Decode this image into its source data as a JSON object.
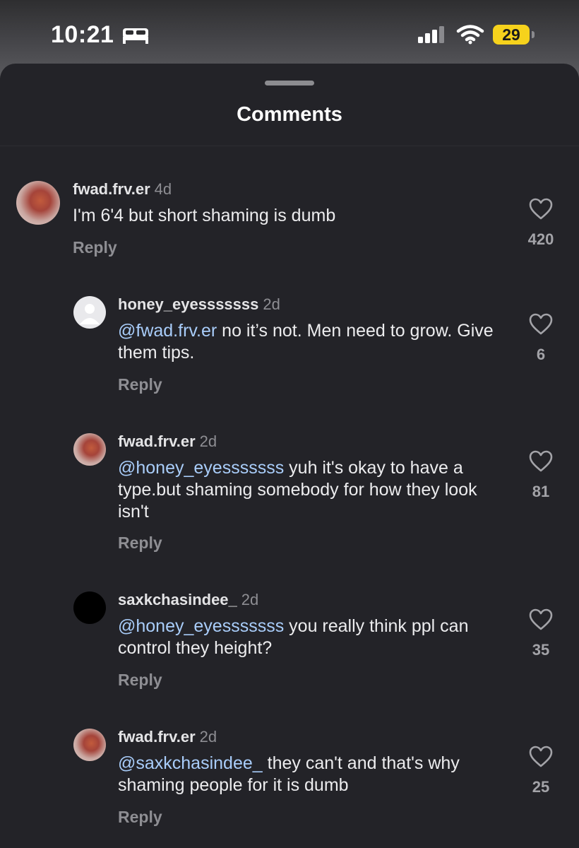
{
  "status_bar": {
    "time": "10:21",
    "battery": "29"
  },
  "sheet": {
    "title": "Comments"
  },
  "comments": [
    {
      "username": "fwad.frv.er",
      "age": "4d",
      "mention": "",
      "text": "I'm 6'4 but short shaming is dumb",
      "reply_label": "Reply",
      "likes": "420"
    },
    {
      "username": "honey_eyesssssss",
      "age": "2d",
      "mention": "@fwad.frv.er",
      "text": " no it’s not. Men need to grow. Give them tips.",
      "reply_label": "Reply",
      "likes": "6"
    },
    {
      "username": "fwad.frv.er",
      "age": "2d",
      "mention": "@honey_eyesssssss",
      "text": " yuh it's okay to have a type.but shaming somebody for how they look isn't",
      "reply_label": "Reply",
      "likes": "81"
    },
    {
      "username": "saxkchasindee_",
      "age": "2d",
      "mention": "@honey_eyesssssss",
      "text": " you really think ppl can control they height?",
      "reply_label": "Reply",
      "likes": "35"
    },
    {
      "username": "fwad.frv.er",
      "age": "2d",
      "mention": "@saxkchasindee_",
      "text": " they can't and that's why shaming people for it is dumb",
      "reply_label": "Reply",
      "likes": "25"
    }
  ]
}
